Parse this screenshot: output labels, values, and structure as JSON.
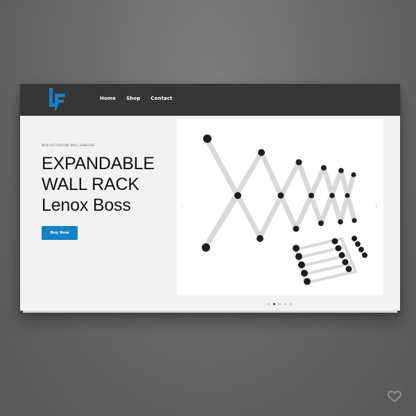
{
  "header": {
    "logo_icon": "lf-logo-icon",
    "brand_color": "#1681c4",
    "nav": [
      {
        "label": "Home"
      },
      {
        "label": "Shop"
      },
      {
        "label": "Contact"
      }
    ]
  },
  "hero": {
    "eyebrow": "NEW ACCORDION WALL HANGERS",
    "title_line1": "EXPANDABLE",
    "title_line2": "WALL RACK",
    "title_line3": "Lenox Boss",
    "cta_label": "Buy Now",
    "product_image": "accordion-wall-rack-photo",
    "prev_icon": "chevron-left-icon",
    "next_icon": "chevron-right-icon"
  },
  "carousel": {
    "slide_count": 5,
    "active_index": 1
  },
  "overlay": {
    "heart_icon": "heart-icon"
  }
}
